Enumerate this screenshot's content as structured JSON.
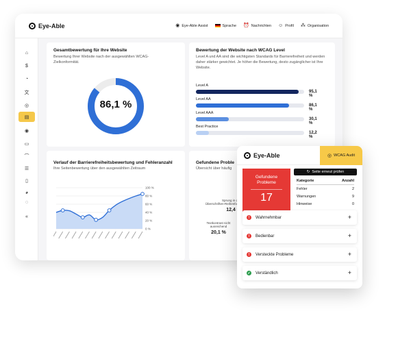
{
  "app": {
    "brand": "Eye-Able",
    "trademark": "®"
  },
  "topnav": [
    {
      "label": "Eye-Able Assist",
      "icon": "assist-icon"
    },
    {
      "label": "Sprache",
      "icon": "german-flag-icon"
    },
    {
      "label": "Nachrichten",
      "icon": "alarm-icon"
    },
    {
      "label": "Profil",
      "icon": "user-icon"
    },
    {
      "label": "Organisation",
      "icon": "organisation-icon"
    }
  ],
  "sidebar": [
    {
      "icon": "home-icon",
      "glyph": "⌂"
    },
    {
      "icon": "dollar-icon",
      "glyph": "$"
    },
    {
      "icon": "gauge-icon",
      "glyph": "◔"
    },
    {
      "icon": "translate-icon",
      "glyph": "文"
    },
    {
      "icon": "broadcast-icon",
      "glyph": "◎"
    },
    {
      "icon": "clipboard-icon",
      "glyph": "▤",
      "active": true
    },
    {
      "icon": "target-icon",
      "glyph": "◉"
    },
    {
      "icon": "document-icon",
      "glyph": "▭"
    },
    {
      "icon": "chart-icon",
      "glyph": "⌒"
    },
    {
      "icon": "list-icon",
      "glyph": "☰"
    },
    {
      "icon": "file-icon",
      "glyph": "▯"
    },
    {
      "icon": "pie-icon",
      "glyph": "◕"
    },
    {
      "icon": "chat-icon",
      "glyph": "◌"
    },
    {
      "icon": "collapse-icon",
      "glyph": "«"
    }
  ],
  "overall": {
    "title": "Gesamtbewertung für Ihre Website",
    "subtitle": "Bewertung Ihrer Website nach der ausgewählten WCAG-Zielkonformität.",
    "value_label": "86,1 %",
    "value": 86.1,
    "color": "#2f6fd6"
  },
  "levels": {
    "title": "Bewertung der Website nach WCAG Level",
    "subtitle": "Level A und AA sind die wichtigsten Standards für Barrierefreiheit und werden daher stärker gewichtet. Je höher die Bewertung, desto zugänglicher ist Ihre Website.",
    "items": [
      {
        "label": "Level A",
        "value_label": "95,1 %",
        "value": 95.1,
        "color": "#13265e"
      },
      {
        "label": "Level AA",
        "value_label": "86,1 %",
        "value": 86.1,
        "color": "#2f6fd6"
      },
      {
        "label": "Level AAA",
        "value_label": "30,1 %",
        "value": 30.1,
        "color": "#5b8fe0"
      },
      {
        "label": "Best Practice",
        "value_label": "12,2 %",
        "value": 12.2,
        "color": "#b9d0f3"
      }
    ]
  },
  "trend": {
    "title": "Verlauf der Barrierefreiheitsbewertung und Fehleranzahl",
    "subtitle": "Ihre Seitenbewertung über den ausgewählten Zeitraum"
  },
  "chart_data": {
    "type": "area",
    "title": "Verlauf der Barrierefreiheitsbewertung und Fehleranzahl",
    "x": [
      "",
      "",
      "",
      "",
      "",
      "",
      "",
      "",
      "",
      "",
      "",
      "",
      "",
      ""
    ],
    "series": [
      {
        "values": [
          40,
          45,
          44,
          36,
          28,
          34,
          22,
          28,
          45,
          58,
          67,
          74,
          80,
          85
        ]
      }
    ],
    "markers": [
      1,
      4,
      6,
      8,
      13
    ],
    "ylim": [
      0,
      100
    ],
    "yticks": [
      "100 %",
      "80 %",
      "60 %",
      "40 %",
      "20 %",
      "0 %"
    ],
    "grid": true,
    "color": "#2f6fd6"
  },
  "issues_card": {
    "title": "Gefundene Proble",
    "subtitle": "Übersicht über häufig",
    "items": [
      {
        "label_line1": "Sprung in den",
        "label_line2": "Überschriften-Reihenfolge",
        "value": "12,4 %"
      },
      {
        "label_line1": "Textkontrast nicht",
        "label_line2": "ausreichend",
        "value": "20,1 %"
      }
    ]
  },
  "audit": {
    "brand": "Eye-Able",
    "tab_label": "WCAG Audit",
    "found_label_1": "Gefundene",
    "found_label_2": "Probleme",
    "found_count": "17",
    "recheck_label": "Seite erneut prüfen",
    "table_headers": [
      "Kategorie",
      "Anzahl"
    ],
    "table_rows": [
      {
        "category": "Fehler",
        "count": "2"
      },
      {
        "category": "Warnungen",
        "count": "9"
      },
      {
        "category": "Hinweise",
        "count": "0"
      }
    ],
    "accordion": [
      {
        "label": "Wahrnehmbar",
        "status": "error",
        "color": "#e53935"
      },
      {
        "label": "Bedienbar",
        "status": "error",
        "color": "#e53935"
      },
      {
        "label": "Versteckte Probleme",
        "status": "error",
        "color": "#e53935"
      },
      {
        "label": "Verständlich",
        "status": "ok",
        "color": "#2e9e4f"
      }
    ]
  }
}
